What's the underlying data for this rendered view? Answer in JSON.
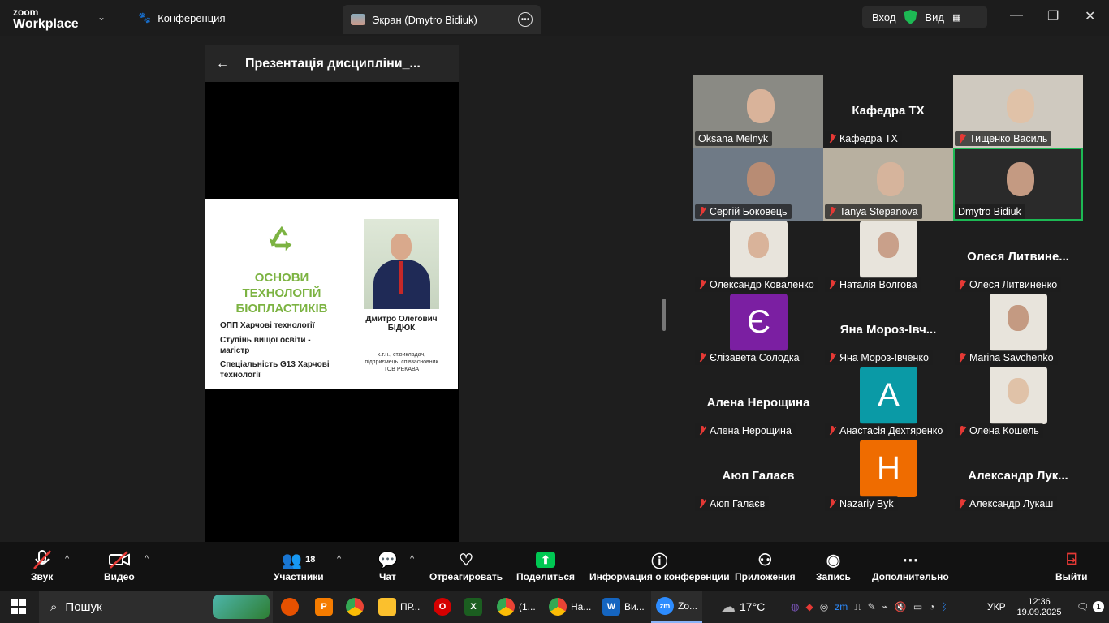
{
  "topbar": {
    "logo_line1": "zoom",
    "logo_line2": "Workplace",
    "conference_label": "Конференция",
    "screen_tab_label": "Экран (Dmytro Bidiuk)",
    "entry_label": "Вход",
    "view_label": "Вид"
  },
  "share": {
    "title": "Презентація дисципліни_...",
    "slide": {
      "title_line1": "ОСНОВИ",
      "title_line2": "ТЕХНОЛОГІЙ",
      "title_line3": "БІОПЛАСТИКІВ",
      "info1": "ОПП Харчові технології",
      "info2": "Ступінь вищої освіти - магістр",
      "info3": "Спеціальність G13 Харчові технології",
      "person_name": "Дмитро Олегович БІДЮК",
      "person_desc": "к.т.н., ст.викладач, підприємець, співзасновник ТОВ РЕКАВА"
    }
  },
  "participants": [
    {
      "name": "Oksana Melnyk",
      "type": "video",
      "muted": false
    },
    {
      "name": "Кафедра ТХ",
      "big": "Кафедра ТХ",
      "type": "name",
      "muted": true
    },
    {
      "name": "Тищенко Василь",
      "type": "video",
      "muted": true
    },
    {
      "name": "Сергій Боковець",
      "type": "video",
      "muted": true
    },
    {
      "name": "Tanya Stepanova",
      "type": "video",
      "muted": true
    },
    {
      "name": "Dmytro Bidiuk",
      "type": "video",
      "muted": false,
      "active": true
    },
    {
      "name": "Олександр Коваленко",
      "type": "photo",
      "muted": true
    },
    {
      "name": "Наталія Волгова",
      "type": "photo",
      "muted": true
    },
    {
      "name": "Олеся Литвиненко",
      "big": "Олеся  Литвине...",
      "type": "name",
      "muted": true
    },
    {
      "name": "Єлізавета Солодка",
      "type": "letter",
      "letter": "Є",
      "color": "#7b1fa2",
      "muted": true
    },
    {
      "name": "Яна Мороз-Івченко",
      "big": "Яна  Мороз-Івч...",
      "type": "name",
      "muted": true
    },
    {
      "name": "Marina Savchenko",
      "type": "photo",
      "muted": true
    },
    {
      "name": "Алена Нерощина",
      "big": "Алена Нерощина",
      "type": "name",
      "muted": true
    },
    {
      "name": "Анастасія Дехтяренко",
      "type": "letter",
      "letter": "A",
      "color": "#0a9aa6",
      "muted": true
    },
    {
      "name": "Олена Кошель",
      "type": "photo",
      "muted": true
    },
    {
      "name": "Аюп Галаєв",
      "big": "Аюп Галаєв",
      "type": "name",
      "muted": true
    },
    {
      "name": "Nazariy Byk",
      "type": "letter",
      "letter": "H",
      "color": "#ef6c00",
      "muted": true
    },
    {
      "name": "Александр Лукаш",
      "big": "Александр  Лук...",
      "type": "name",
      "muted": true
    }
  ],
  "controls": {
    "audio": "Звук",
    "video": "Видео",
    "participants": "Участники",
    "participants_count": "18",
    "chat": "Чат",
    "react": "Отреагировать",
    "share": "Поделиться",
    "info": "Информация о конференции",
    "apps": "Приложения",
    "record": "Запись",
    "more": "Дополнительно",
    "leave": "Выйти"
  },
  "taskbar": {
    "search": "Пошук",
    "app_pr": "ПР...",
    "app_chrome1": "(1...",
    "app_chrome2": "На...",
    "app_word": "Ви...",
    "app_zoom": "Zo...",
    "temperature": "17°C",
    "lang": "УКР",
    "time": "12:36",
    "date": "19.09.2025",
    "notifications": "1"
  },
  "colors": {
    "accent_green": "#1db954",
    "share_green": "#00c853",
    "slide_title": "#7cb342",
    "mute_red": "#e53935"
  }
}
